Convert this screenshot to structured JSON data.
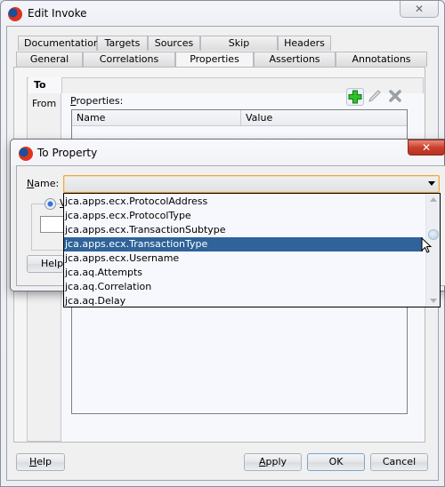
{
  "window": {
    "title": "Edit Invoke",
    "close_glyph": "✕"
  },
  "tabs": {
    "row1": [
      "Documentation",
      "Targets",
      "Sources",
      "Skip Condition",
      "Headers"
    ],
    "row2": [
      "General",
      "Correlations",
      "Properties",
      "Assertions",
      "Annotations"
    ],
    "active": "Properties"
  },
  "side_tabs": {
    "to": "To",
    "from": "From"
  },
  "properties": {
    "label": "Properties:",
    "label_mnemonic": "P",
    "label_rest": "roperties:",
    "columns": [
      "Name",
      "Value"
    ],
    "toolbar": {
      "add_glyph": "✚",
      "edit_glyph": "✎",
      "delete_glyph": "✖"
    }
  },
  "to_property_dialog": {
    "title": "To Property",
    "close_glyph": "✕",
    "name_label_mnemonic": "N",
    "name_label_rest": "ame:",
    "name_value": "",
    "radio_label": "V",
    "help_label": "Help",
    "dropdown_options": [
      "jca.apps.ecx.ProtocolAddress",
      "jca.apps.ecx.ProtocolType",
      "jca.apps.ecx.TransactionSubtype",
      "jca.apps.ecx.TransactionType",
      "jca.apps.ecx.Username",
      "jca.aq.Attempts",
      "jca.aq.Correlation",
      "jca.aq.Delay"
    ],
    "selected_option": "jca.apps.ecx.TransactionType",
    "colors": {
      "selection_bg": "#2f6399",
      "focus_border": "#e8a94a",
      "close_button": "#c9412e"
    }
  },
  "buttons": {
    "help_mnemonic": "H",
    "help_rest": "elp",
    "apply_mnemonic": "A",
    "apply_rest": "pply",
    "ok": "OK",
    "cancel": "Cancel"
  }
}
